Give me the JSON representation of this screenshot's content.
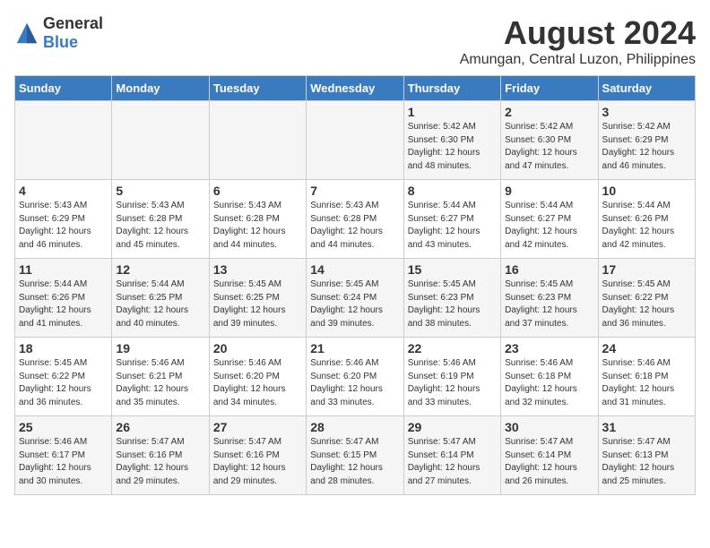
{
  "header": {
    "logo_general": "General",
    "logo_blue": "Blue",
    "month_year": "August 2024",
    "location": "Amungan, Central Luzon, Philippines"
  },
  "days_of_week": [
    "Sunday",
    "Monday",
    "Tuesday",
    "Wednesday",
    "Thursday",
    "Friday",
    "Saturday"
  ],
  "weeks": [
    [
      {
        "day": "",
        "info": ""
      },
      {
        "day": "",
        "info": ""
      },
      {
        "day": "",
        "info": ""
      },
      {
        "day": "",
        "info": ""
      },
      {
        "day": "1",
        "info": "Sunrise: 5:42 AM\nSunset: 6:30 PM\nDaylight: 12 hours\nand 48 minutes."
      },
      {
        "day": "2",
        "info": "Sunrise: 5:42 AM\nSunset: 6:30 PM\nDaylight: 12 hours\nand 47 minutes."
      },
      {
        "day": "3",
        "info": "Sunrise: 5:42 AM\nSunset: 6:29 PM\nDaylight: 12 hours\nand 46 minutes."
      }
    ],
    [
      {
        "day": "4",
        "info": "Sunrise: 5:43 AM\nSunset: 6:29 PM\nDaylight: 12 hours\nand 46 minutes."
      },
      {
        "day": "5",
        "info": "Sunrise: 5:43 AM\nSunset: 6:28 PM\nDaylight: 12 hours\nand 45 minutes."
      },
      {
        "day": "6",
        "info": "Sunrise: 5:43 AM\nSunset: 6:28 PM\nDaylight: 12 hours\nand 44 minutes."
      },
      {
        "day": "7",
        "info": "Sunrise: 5:43 AM\nSunset: 6:28 PM\nDaylight: 12 hours\nand 44 minutes."
      },
      {
        "day": "8",
        "info": "Sunrise: 5:44 AM\nSunset: 6:27 PM\nDaylight: 12 hours\nand 43 minutes."
      },
      {
        "day": "9",
        "info": "Sunrise: 5:44 AM\nSunset: 6:27 PM\nDaylight: 12 hours\nand 42 minutes."
      },
      {
        "day": "10",
        "info": "Sunrise: 5:44 AM\nSunset: 6:26 PM\nDaylight: 12 hours\nand 42 minutes."
      }
    ],
    [
      {
        "day": "11",
        "info": "Sunrise: 5:44 AM\nSunset: 6:26 PM\nDaylight: 12 hours\nand 41 minutes."
      },
      {
        "day": "12",
        "info": "Sunrise: 5:44 AM\nSunset: 6:25 PM\nDaylight: 12 hours\nand 40 minutes."
      },
      {
        "day": "13",
        "info": "Sunrise: 5:45 AM\nSunset: 6:25 PM\nDaylight: 12 hours\nand 39 minutes."
      },
      {
        "day": "14",
        "info": "Sunrise: 5:45 AM\nSunset: 6:24 PM\nDaylight: 12 hours\nand 39 minutes."
      },
      {
        "day": "15",
        "info": "Sunrise: 5:45 AM\nSunset: 6:23 PM\nDaylight: 12 hours\nand 38 minutes."
      },
      {
        "day": "16",
        "info": "Sunrise: 5:45 AM\nSunset: 6:23 PM\nDaylight: 12 hours\nand 37 minutes."
      },
      {
        "day": "17",
        "info": "Sunrise: 5:45 AM\nSunset: 6:22 PM\nDaylight: 12 hours\nand 36 minutes."
      }
    ],
    [
      {
        "day": "18",
        "info": "Sunrise: 5:45 AM\nSunset: 6:22 PM\nDaylight: 12 hours\nand 36 minutes."
      },
      {
        "day": "19",
        "info": "Sunrise: 5:46 AM\nSunset: 6:21 PM\nDaylight: 12 hours\nand 35 minutes."
      },
      {
        "day": "20",
        "info": "Sunrise: 5:46 AM\nSunset: 6:20 PM\nDaylight: 12 hours\nand 34 minutes."
      },
      {
        "day": "21",
        "info": "Sunrise: 5:46 AM\nSunset: 6:20 PM\nDaylight: 12 hours\nand 33 minutes."
      },
      {
        "day": "22",
        "info": "Sunrise: 5:46 AM\nSunset: 6:19 PM\nDaylight: 12 hours\nand 33 minutes."
      },
      {
        "day": "23",
        "info": "Sunrise: 5:46 AM\nSunset: 6:18 PM\nDaylight: 12 hours\nand 32 minutes."
      },
      {
        "day": "24",
        "info": "Sunrise: 5:46 AM\nSunset: 6:18 PM\nDaylight: 12 hours\nand 31 minutes."
      }
    ],
    [
      {
        "day": "25",
        "info": "Sunrise: 5:46 AM\nSunset: 6:17 PM\nDaylight: 12 hours\nand 30 minutes."
      },
      {
        "day": "26",
        "info": "Sunrise: 5:47 AM\nSunset: 6:16 PM\nDaylight: 12 hours\nand 29 minutes."
      },
      {
        "day": "27",
        "info": "Sunrise: 5:47 AM\nSunset: 6:16 PM\nDaylight: 12 hours\nand 29 minutes."
      },
      {
        "day": "28",
        "info": "Sunrise: 5:47 AM\nSunset: 6:15 PM\nDaylight: 12 hours\nand 28 minutes."
      },
      {
        "day": "29",
        "info": "Sunrise: 5:47 AM\nSunset: 6:14 PM\nDaylight: 12 hours\nand 27 minutes."
      },
      {
        "day": "30",
        "info": "Sunrise: 5:47 AM\nSunset: 6:14 PM\nDaylight: 12 hours\nand 26 minutes."
      },
      {
        "day": "31",
        "info": "Sunrise: 5:47 AM\nSunset: 6:13 PM\nDaylight: 12 hours\nand 25 minutes."
      }
    ]
  ]
}
